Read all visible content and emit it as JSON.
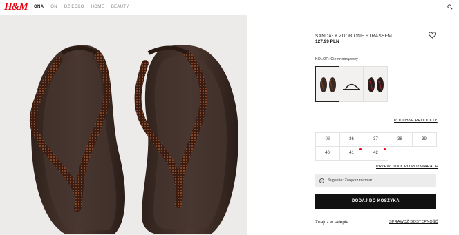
{
  "header": {
    "logo": "H&M",
    "nav": [
      "ONA",
      "ON",
      "DZIECKO",
      "HOME",
      "BEAUTY"
    ],
    "active_index": 0,
    "search_icon": "search-icon"
  },
  "product": {
    "title": "SANDAŁY ZDOBIONE STRASSEM",
    "price": "127,99 PLN",
    "color_label": "KOLOR: Ciemnobrązowy",
    "similar_link": "PODOBNE PRODUKTY",
    "sizes": [
      {
        "label": "~98-",
        "disabled": true,
        "low_stock": false
      },
      {
        "label": "36",
        "disabled": false,
        "low_stock": false
      },
      {
        "label": "37",
        "disabled": false,
        "low_stock": false
      },
      {
        "label": "38",
        "disabled": false,
        "low_stock": false
      },
      {
        "label": "39",
        "disabled": false,
        "low_stock": false
      },
      {
        "label": "40",
        "disabled": false,
        "low_stock": false
      },
      {
        "label": "41",
        "disabled": false,
        "low_stock": true
      },
      {
        "label": "42",
        "disabled": false,
        "low_stock": true
      }
    ],
    "size_guide_link": "PRZEWODNIK PO ROZMIARACH",
    "size_tip": "Sugestie: Zwiększ rozmiar",
    "add_to_cart": "DODAJ DO KOSZYKA",
    "find_in_store": "Znajdź w sklepie",
    "check_availability": "SPRAWDŹ DOSTĘPNOŚĆ"
  },
  "colors": {
    "brand": "#e50010",
    "button_bg": "#111111",
    "sandal_sole": "#3a2a24",
    "strap": "#4a2a20"
  }
}
